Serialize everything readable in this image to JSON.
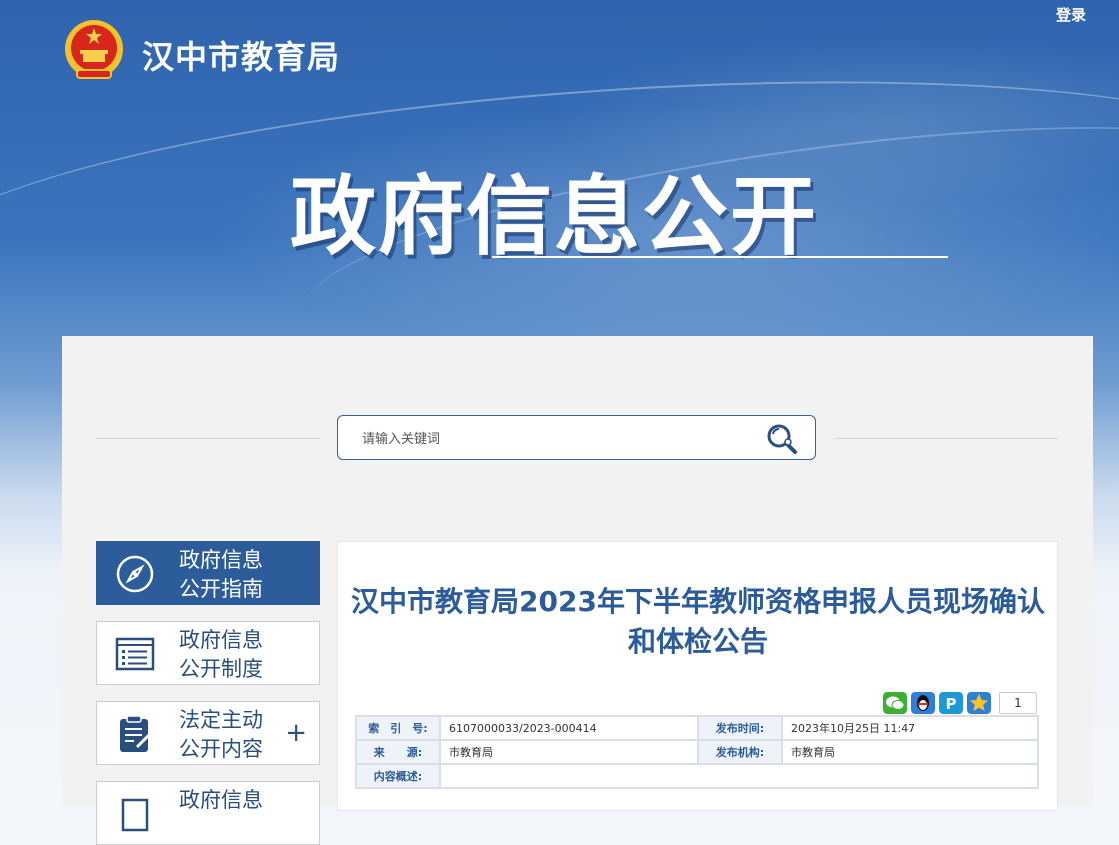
{
  "header": {
    "site_name": "汉中市教育局",
    "login_label": "登录",
    "emblem": "national-emblem",
    "big_title": "政府信息公开"
  },
  "search": {
    "placeholder": "请输入关键词",
    "icon": "search-icon"
  },
  "sidebar": {
    "items": [
      {
        "label_line1": "政府信息",
        "label_line2": "公开指南",
        "icon": "compass-icon",
        "active": true,
        "expandable": false
      },
      {
        "label_line1": "政府信息",
        "label_line2": "公开制度",
        "icon": "list-document-icon",
        "active": false,
        "expandable": false
      },
      {
        "label_line1": "法定主动",
        "label_line2": "公开内容",
        "icon": "clipboard-edit-icon",
        "active": false,
        "expandable": true,
        "expand_symbol": "+"
      },
      {
        "label_line1": "政府信息",
        "label_line2": "",
        "icon": "document-icon",
        "active": false,
        "expandable": false
      }
    ]
  },
  "article": {
    "title": "汉中市教育局2023年下半年教师资格申报人员现场确认和体检公告",
    "share_icons": [
      "wechat-icon",
      "qq-icon",
      "qzone-icon",
      "favorite-star-icon"
    ],
    "share_count": "1",
    "meta": {
      "index_label": "索　引　号:",
      "index_value": "6107000033/2023-000414",
      "publish_time_label": "发布时间:",
      "publish_time_value": "2023年10月25日 11:47",
      "source_label": "来　　源:",
      "source_value": "市教育局",
      "publisher_label": "发布机构:",
      "publisher_value": "市教育局",
      "summary_label": "内容概述:",
      "summary_value": ""
    }
  },
  "colors": {
    "brand_blue": "#2d5c9b",
    "title_blue": "#2b5b98",
    "header_gradient_top": "#2f64ad"
  }
}
